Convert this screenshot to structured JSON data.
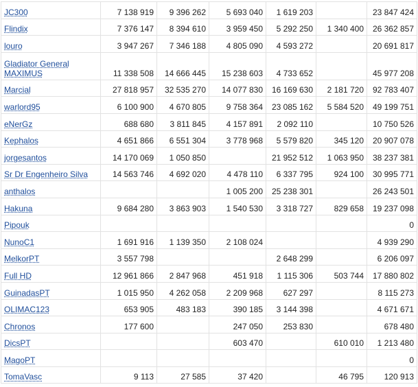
{
  "rows": [
    {
      "player": "JC300",
      "values": [
        "7 138 919",
        "9 396 262",
        "5 693 040",
        "1 619 203",
        "",
        "23 847 424"
      ]
    },
    {
      "player": "Flindix",
      "values": [
        "7 376 147",
        "8 394 610",
        "3 959 450",
        "5 292 250",
        "1 340 400",
        "26 362 857"
      ]
    },
    {
      "player": "louro",
      "values": [
        "3 947 267",
        "7 346 188",
        "4 805 090",
        "4 593 272",
        "",
        "20 691 817"
      ]
    },
    {
      "player": "Gladiator General MAXIMUS",
      "values": [
        "11 338 508",
        "14 666 445",
        "15 238 603",
        "4 733 652",
        "",
        "45 977 208"
      ]
    },
    {
      "player": "Marcial",
      "values": [
        "27 818 957",
        "32 535 270",
        "14 077 830",
        "16 169 630",
        "2 181 720",
        "92 783 407"
      ]
    },
    {
      "player": "warlord95",
      "values": [
        "6 100 900",
        "4 670 805",
        "9 758 364",
        "23 085 162",
        "5 584 520",
        "49 199 751"
      ]
    },
    {
      "player": "eNerGz",
      "values": [
        "688 680",
        "3 811 845",
        "4 157 891",
        "2 092 110",
        "",
        "10 750 526"
      ]
    },
    {
      "player": "Kephalos",
      "values": [
        "4 651 866",
        "6 551 304",
        "3 778 968",
        "5 579 820",
        "345 120",
        "20 907 078"
      ]
    },
    {
      "player": "jorgesantos",
      "values": [
        "14 170 069",
        "1 050 850",
        "",
        "21 952 512",
        "1 063 950",
        "38 237 381"
      ]
    },
    {
      "player": "Sr Dr Engenheiro Silva",
      "values": [
        "14 563 746",
        "4 692 020",
        "4 478 110",
        "6 337 795",
        "924 100",
        "30 995 771"
      ]
    },
    {
      "player": "anthalos",
      "values": [
        "",
        "",
        "1 005 200",
        "25 238 301",
        "",
        "26 243 501"
      ]
    },
    {
      "player": "Hakuna",
      "values": [
        "9 684 280",
        "3 863 903",
        "1 540 530",
        "3 318 727",
        "829 658",
        "19 237 098"
      ]
    },
    {
      "player": "Pipouk",
      "values": [
        "",
        "",
        "",
        "",
        "",
        "0"
      ]
    },
    {
      "player": "NunoC1",
      "values": [
        "1 691 916",
        "1 139 350",
        "2 108 024",
        "",
        "",
        "4 939 290"
      ]
    },
    {
      "player": "MelkorPT",
      "values": [
        "3 557 798",
        "",
        "",
        "2 648 299",
        "",
        "6 206 097"
      ]
    },
    {
      "player": "Full HD",
      "values": [
        "12 961 866",
        "2 847 968",
        "451 918",
        "1 115 306",
        "503 744",
        "17 880 802"
      ]
    },
    {
      "player": "GuinadasPT",
      "values": [
        "1 015 950",
        "4 262 058",
        "2 209 968",
        "627 297",
        "",
        "8 115 273"
      ]
    },
    {
      "player": "OLIMAC123",
      "values": [
        "653 905",
        "483 183",
        "390 185",
        "3 144 398",
        "",
        "4 671 671"
      ]
    },
    {
      "player": "Chronos",
      "values": [
        "177 600",
        "",
        "247 050",
        "253 830",
        "",
        "678 480"
      ]
    },
    {
      "player": "DicsPT",
      "values": [
        "",
        "",
        "603 470",
        "",
        "610 010",
        "1 213 480"
      ]
    },
    {
      "player": "MagoPT",
      "values": [
        "",
        "",
        "",
        "",
        "",
        "0"
      ]
    },
    {
      "player": "TomaVasc",
      "values": [
        "9 113",
        "27 585",
        "37 420",
        "",
        "46 795",
        "120 913"
      ]
    }
  ]
}
